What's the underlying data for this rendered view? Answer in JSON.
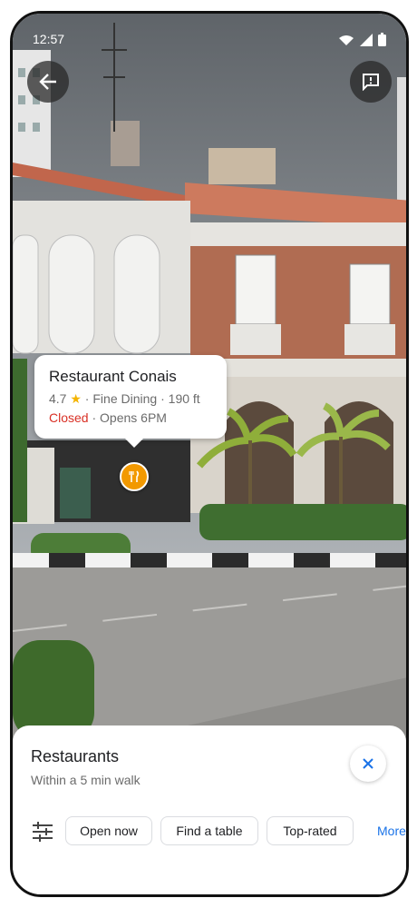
{
  "status_bar": {
    "time": "12:57"
  },
  "place_callout": {
    "name": "Restaurant Conais",
    "rating": "4.7",
    "category": "Fine Dining",
    "distance": "190 ft",
    "status": "Closed",
    "opens": "Opens 6PM"
  },
  "sheet": {
    "title": "Restaurants",
    "subtitle": "Within a 5 min walk",
    "chips": [
      "Open now",
      "Find a table",
      "Top-rated"
    ],
    "more": "More"
  },
  "colors": {
    "accent": "#1a73e8",
    "closed": "#d93025",
    "pin": "#f29900",
    "star": "#f4b400"
  },
  "icons": [
    "back-arrow-icon",
    "feedback-icon",
    "wifi-icon",
    "signal-icon",
    "battery-icon",
    "fork-knife-icon",
    "close-icon",
    "filter-icon",
    "star-icon"
  ]
}
